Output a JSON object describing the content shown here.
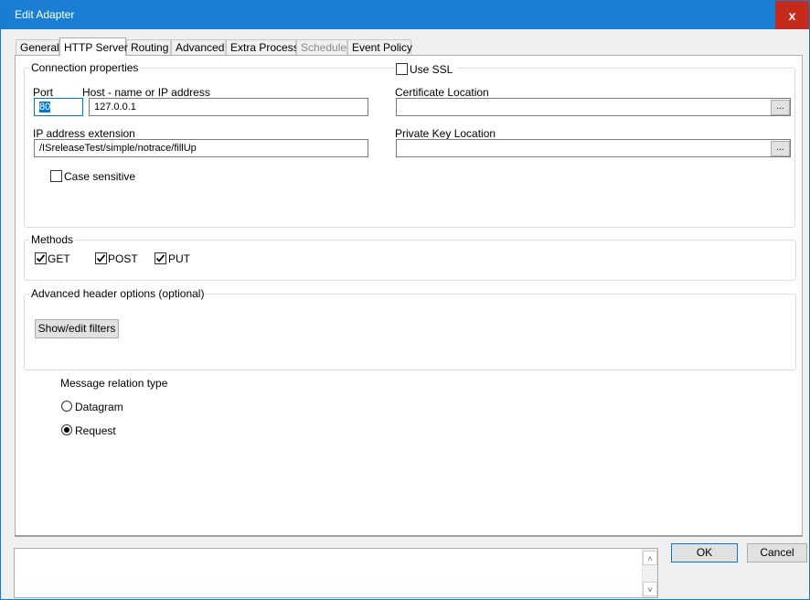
{
  "window": {
    "title": "Edit Adapter",
    "close_glyph": "x"
  },
  "tabs": [
    {
      "label": "General",
      "state": "normal"
    },
    {
      "label": "HTTP Server",
      "state": "active"
    },
    {
      "label": "Routing",
      "state": "normal"
    },
    {
      "label": "Advanced",
      "state": "normal"
    },
    {
      "label": "Extra Process",
      "state": "normal"
    },
    {
      "label": "Schedule",
      "state": "disabled"
    },
    {
      "label": "Event Policy",
      "state": "normal"
    }
  ],
  "connection": {
    "group_label": "Connection properties",
    "port_label": "Port",
    "port_value": "80",
    "host_label": "Host - name or IP address",
    "host_value": "127.0.0.1",
    "ip_ext_label": "IP address extension",
    "ip_ext_value": "/ISreleaseTest/simple/notrace/fillUp",
    "case_sensitive_label": "Case sensitive",
    "case_sensitive_checked": false
  },
  "ssl": {
    "use_ssl_label": "Use SSL",
    "use_ssl_checked": false,
    "cert_label": "Certificate Location",
    "cert_value": "",
    "key_label": "Private Key Location",
    "key_value": "",
    "browse_label": "..."
  },
  "methods": {
    "group_label": "Methods",
    "items": [
      {
        "label": "GET",
        "checked": true
      },
      {
        "label": "POST",
        "checked": true
      },
      {
        "label": "PUT",
        "checked": true
      }
    ]
  },
  "advanced_headers": {
    "group_label": "Advanced header options (optional)",
    "button_label": "Show/edit filters"
  },
  "relation": {
    "label": "Message relation type",
    "options": [
      {
        "label": "Datagram",
        "selected": false
      },
      {
        "label": "Request",
        "selected": true
      }
    ]
  },
  "footer": {
    "ok_label": "OK",
    "cancel_label": "Cancel"
  },
  "colors": {
    "titlebar": "#1a7fd4",
    "close_button": "#c42b1c",
    "selection": "#0078d7"
  },
  "icons": {
    "close": "x-glyph",
    "check": "checkmark",
    "scroll_up": "chevron-up-icon",
    "scroll_down": "chevron-down-icon"
  }
}
